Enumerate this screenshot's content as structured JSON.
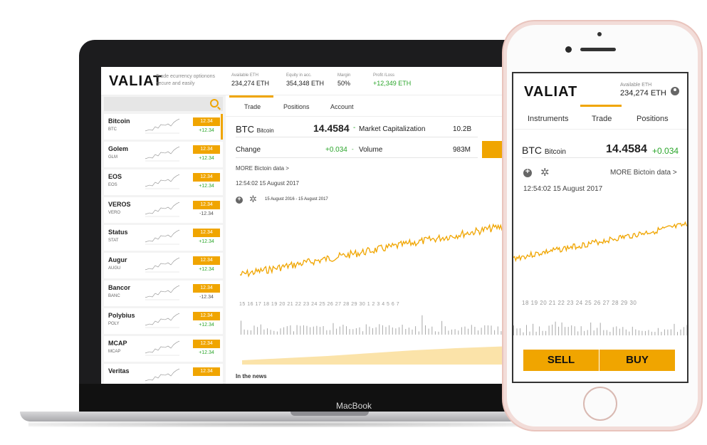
{
  "web": {
    "logo": "VALIAT",
    "tagline": "Trade ecurrency optionons secure and easily",
    "stats": [
      {
        "label": "Available ETH",
        "value": "234,274 ETH",
        "green": false
      },
      {
        "label": "Equity in acc.",
        "value": "354,348 ETH",
        "green": false
      },
      {
        "label": "Margin",
        "value": "50%",
        "green": false
      },
      {
        "label": "Profit /Loss",
        "value": "+12,349 ETH",
        "green": true
      }
    ],
    "coins": [
      {
        "name": "Bitcoin",
        "symbol": "BTC",
        "price": "12.34",
        "change": "+12.34"
      },
      {
        "name": "Golem",
        "symbol": "GLM",
        "price": "12.34",
        "change": "+12.34"
      },
      {
        "name": "EOS",
        "symbol": "EOS",
        "price": "12.34",
        "change": "+12.34"
      },
      {
        "name": "VEROS",
        "symbol": "VERO",
        "price": "12.34",
        "change": "-12.34"
      },
      {
        "name": "Status",
        "symbol": "STAT",
        "price": "12.34",
        "change": "+12.34"
      },
      {
        "name": "Augur",
        "symbol": "AUGU",
        "price": "12.34",
        "change": "+12.34"
      },
      {
        "name": "Bancor",
        "symbol": "BANC",
        "price": "12.34",
        "change": "-12.34"
      },
      {
        "name": "Polybius",
        "symbol": "POLY",
        "price": "12.34",
        "change": "+12.34"
      },
      {
        "name": "MCAP",
        "symbol": "MCAP",
        "price": "12.34",
        "change": "+12.34"
      },
      {
        "name": "Veritas",
        "symbol": "",
        "price": "12.34",
        "change": ""
      }
    ],
    "tabs": [
      "Trade",
      "Positions",
      "Account"
    ],
    "btc_label": "BTC",
    "btc_name": "Bitcoin",
    "btc_price": "14.4584",
    "btc_arrow": "-",
    "market_cap_label": "Market Capitalization",
    "market_cap_value": "10.2B",
    "change_label": "Change",
    "change_value": "+0.034",
    "volume_arrow": "-",
    "volume_label": "Volume",
    "volume_value": "983M",
    "more_label": "MORE Bictoin data",
    "more_chevron": ">",
    "timestamp": "12:54:02  15 August 2017",
    "date_range": "15 August 2016  -  15 August 2017",
    "axis_ticks": "15  16  17  18  19  20  21  22  23  24  25  26  27  28  29  30   1   2   3   4   5   6   7",
    "news_label": "In the news"
  },
  "laptop_label": "MacBook",
  "mobile": {
    "logo": "VALIAT",
    "eth_label": "Available ETH",
    "eth_value": "234,274 ETH",
    "tabs": [
      "Instruments",
      "Trade",
      "Positions"
    ],
    "btc_label": "BTC",
    "btc_name": "Bitcoin",
    "btc_price": "14.4584",
    "btc_change": "+0.034",
    "more_label": "MORE Bictoin data",
    "more_chevron": ">",
    "timestamp": "12:54:02  15 August 2017",
    "axis_ticks": "18   19   20   21   22   23   24   25   26   27   28   29   30",
    "sell_label": "SELL",
    "buy_label": "BUY"
  },
  "colors": {
    "accent": "#f0a500",
    "up": "#2aa52a"
  }
}
